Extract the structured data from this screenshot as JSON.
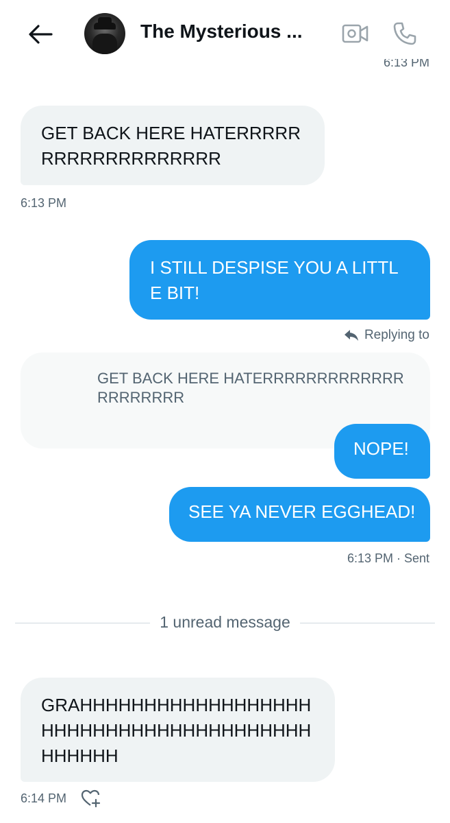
{
  "header": {
    "title": "The Mysterious ...",
    "back_icon": "arrow-left-icon",
    "video_icon": "video-camera-icon",
    "call_icon": "phone-icon"
  },
  "peek_timestamp": "6:13 PM",
  "messages": [
    {
      "direction": "incoming",
      "text": "GET BACK HERE HATERRRRRRRRRRRRRRRRRRR",
      "timestamp": "6:13 PM"
    },
    {
      "direction": "outgoing",
      "text": "I STILL DESPISE YOU A LITTLE BIT!"
    },
    {
      "direction": "outgoing",
      "replying_label": "Replying to",
      "quoted_text": "GET BACK HERE HATERRRRRRRRRRRRRRRRRRRRR",
      "text": "NOPE!"
    },
    {
      "direction": "outgoing",
      "text": "SEE YA NEVER EGGHEAD!",
      "timestamp": "6:13 PM · Sent"
    },
    {
      "direction": "incoming",
      "text": "GRAHHHHHHHHHHHHHHHHHHHHHHHHHHHHHHHHHHHHHHHHHHHHH",
      "timestamp": "6:14 PM"
    }
  ],
  "unread_divider": "1 unread message",
  "colors": {
    "accent": "#1d9bf0",
    "incoming_bubble": "#eff3f4",
    "secondary_text": "#536471"
  }
}
